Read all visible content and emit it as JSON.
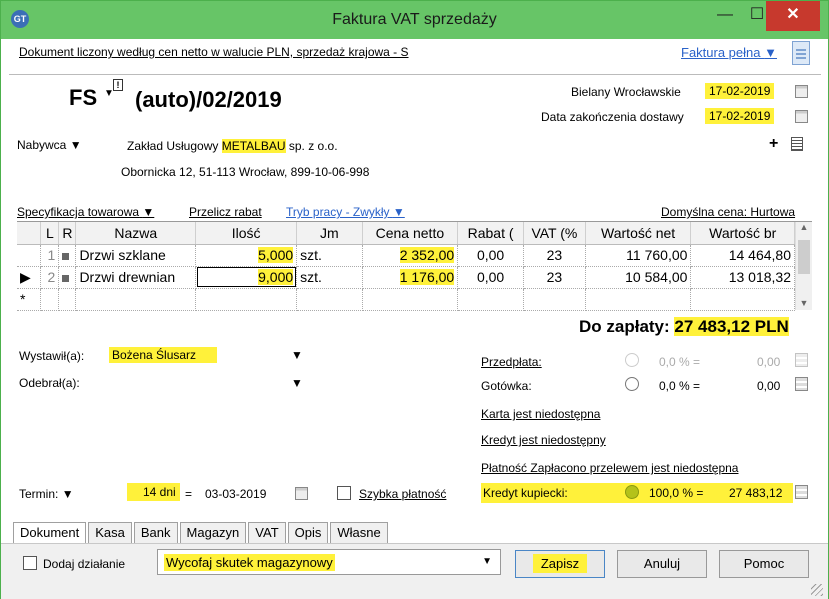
{
  "window": {
    "title": "Faktura VAT sprzedaży",
    "app_icon_text": "GT"
  },
  "subheader": {
    "description": "Dokument liczony według cen netto w walucie PLN, sprzedaż krajowa - S",
    "full_invoice_link": "Faktura pełna"
  },
  "document": {
    "type": "FS",
    "number": "(auto)/02/2019",
    "place_label": "Bielany Wrocławskie",
    "issue_date": "17-02-2019",
    "delivery_end_label": "Data zakończenia dostawy",
    "delivery_end_date": "17-02-2019"
  },
  "buyer": {
    "label": "Nabywca",
    "name_prefix": "Zakład Usługowy ",
    "name_highlight": "METALBAU",
    "name_suffix": " sp. z o.o.",
    "address": "Obornicka 12, 51-113 Wrocław, 899-10-06-998"
  },
  "spec": {
    "label": "Specyfikacja towarowa",
    "recalc_link": "Przelicz rabat",
    "mode_link": "Tryb pracy - Zwykły",
    "default_price": "Domyślna cena: Hurtowa"
  },
  "table": {
    "headers": [
      "L",
      "R",
      "Nazwa",
      "Ilość",
      "Jm",
      "Cena netto",
      "Rabat (",
      "VAT (%",
      "Wartość net",
      "Wartość br"
    ],
    "rows": [
      {
        "marker": "",
        "lp": "1",
        "name": "Drzwi szklane",
        "qty": "5,000",
        "unit": "szt.",
        "price": "2 352,00",
        "discount": "0,00",
        "vat": "23",
        "net": "11 760,00",
        "gross": "14 464,80"
      },
      {
        "marker": "▶",
        "lp": "2",
        "name": "Drzwi drewnian",
        "qty": "9,000",
        "unit": "szt.",
        "price": "1 176,00",
        "discount": "0,00",
        "vat": "23",
        "net": "10 584,00",
        "gross": "13 018,32"
      }
    ],
    "new_row_marker": "*"
  },
  "total": {
    "label": "Do zapłaty:",
    "value": "27 483,12 PLN"
  },
  "people": {
    "issued_label": "Wystawił(a):",
    "issued_value": "Bożena Ślusarz",
    "received_label": "Odebrał(a):",
    "received_value": ""
  },
  "payments": {
    "prepayment_label": "Przedpłata:",
    "prepayment_pct": "0,0 % =",
    "prepayment_amount": "0,00",
    "cash_label": "Gotówka:",
    "cash_pct": "0,0 % =",
    "cash_amount": "0,00",
    "card_unavailable": "Karta jest niedostępna",
    "credit_unavailable": "Kredyt jest niedostępny",
    "transfer_unavailable": "Płatność Zapłacono przelewem jest niedostępna",
    "merchant_credit_label": "Kredyt kupiecki:",
    "merchant_credit_pct": "100,0 % =",
    "merchant_credit_amount": "27 483,12"
  },
  "term": {
    "label": "Termin:",
    "days": "14 dni",
    "eq": "=",
    "date": "03-03-2019",
    "quick_payment": "Szybka płatność"
  },
  "tabs": [
    "Dokument",
    "Kasa",
    "Bank",
    "Magazyn",
    "VAT",
    "Opis",
    "Własne"
  ],
  "footer": {
    "add_action": "Dodaj działanie",
    "action_select": "Wycofaj skutek magazynowy",
    "save": "Zapisz",
    "cancel": "Anuluj",
    "help": "Pomoc"
  },
  "colors": {
    "titlebar": "#67c567",
    "highlight": "#fff13a",
    "close": "#c7392d",
    "link": "#2a62c9"
  }
}
